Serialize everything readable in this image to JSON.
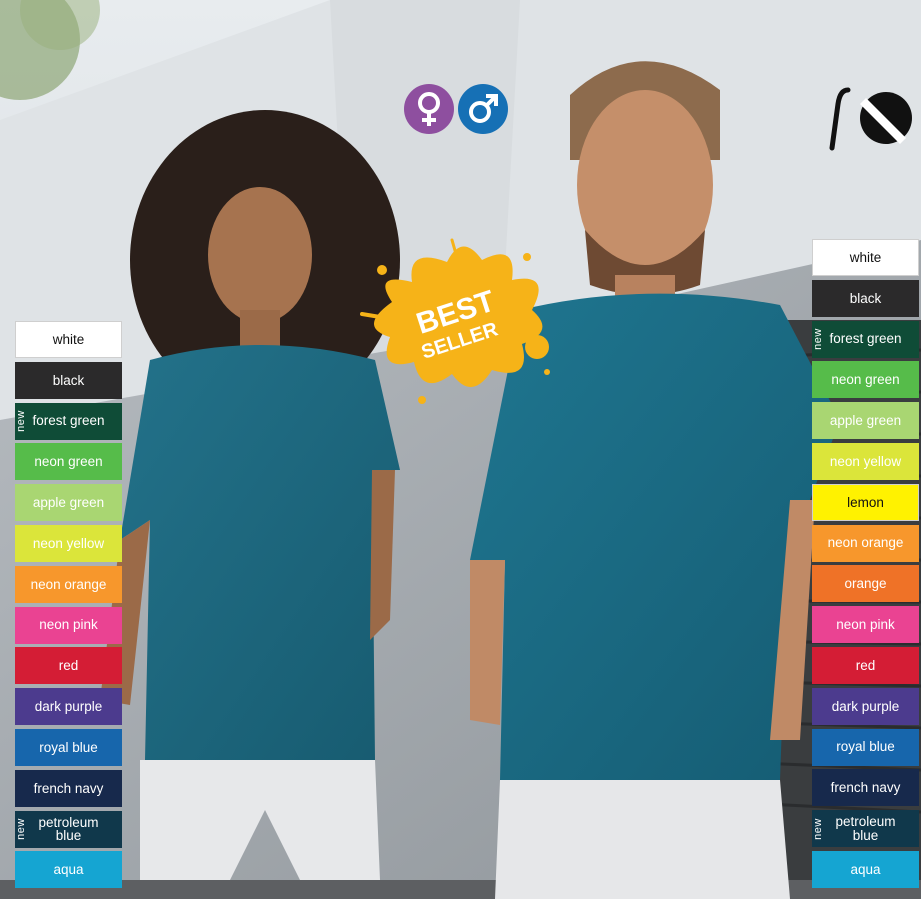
{
  "badge": {
    "line1": "BEST",
    "line2": "SELLER"
  },
  "icons": {
    "female": "female-symbol-icon",
    "male": "male-symbol-icon",
    "brand": "brand-logo-icon"
  },
  "colors": {
    "badge_yellow": "#f6b318",
    "female_purple": "#8e4f9f",
    "male_blue": "#1670b5",
    "tshirt": "#1e6e86"
  },
  "left_palette": [
    {
      "label": "white",
      "color": "#ffffff",
      "is_new": false
    },
    {
      "label": "black",
      "color": "#2b2a2b",
      "is_new": false
    },
    {
      "label": "forest green",
      "color": "#0f4c37",
      "is_new": true,
      "new_label": "new"
    },
    {
      "label": "neon green",
      "color": "#56bc4a",
      "is_new": false
    },
    {
      "label": "apple green",
      "color": "#a9d672",
      "is_new": false
    },
    {
      "label": "neon yellow",
      "color": "#dbe53a",
      "is_new": false
    },
    {
      "label": "neon orange",
      "color": "#f7972c",
      "is_new": false
    },
    {
      "label": "neon pink",
      "color": "#ea4392",
      "is_new": false
    },
    {
      "label": "red",
      "color": "#d41d35",
      "is_new": false
    },
    {
      "label": "dark purple",
      "color": "#4c3b8e",
      "is_new": false
    },
    {
      "label": "royal blue",
      "color": "#1766ac",
      "is_new": false
    },
    {
      "label": "french navy",
      "color": "#17294c",
      "is_new": false
    },
    {
      "label": "petroleum blue",
      "color": "#10384b",
      "is_new": true,
      "new_label": "new"
    },
    {
      "label": "aqua",
      "color": "#15a5d2",
      "is_new": false
    }
  ],
  "right_palette": [
    {
      "label": "white",
      "color": "#ffffff",
      "is_new": false
    },
    {
      "label": "black",
      "color": "#2b2a2b",
      "is_new": false
    },
    {
      "label": "forest green",
      "color": "#0f4c37",
      "is_new": true,
      "new_label": "new"
    },
    {
      "label": "neon green",
      "color": "#56bc4a",
      "is_new": false
    },
    {
      "label": "apple green",
      "color": "#a9d672",
      "is_new": false
    },
    {
      "label": "neon yellow",
      "color": "#dbe53a",
      "is_new": false
    },
    {
      "label": "lemon",
      "color": "#fff200",
      "is_new": false,
      "dark_text": true
    },
    {
      "label": "neon orange",
      "color": "#f7972c",
      "is_new": false
    },
    {
      "label": "orange",
      "color": "#ef7227",
      "is_new": false
    },
    {
      "label": "neon pink",
      "color": "#ea4392",
      "is_new": false
    },
    {
      "label": "red",
      "color": "#d41d35",
      "is_new": false
    },
    {
      "label": "dark purple",
      "color": "#4c3b8e",
      "is_new": false
    },
    {
      "label": "royal blue",
      "color": "#1766ac",
      "is_new": false
    },
    {
      "label": "french navy",
      "color": "#17294c",
      "is_new": false
    },
    {
      "label": "petroleum blue",
      "color": "#10384b",
      "is_new": true,
      "new_label": "new"
    },
    {
      "label": "aqua",
      "color": "#15a5d2",
      "is_new": false
    }
  ]
}
